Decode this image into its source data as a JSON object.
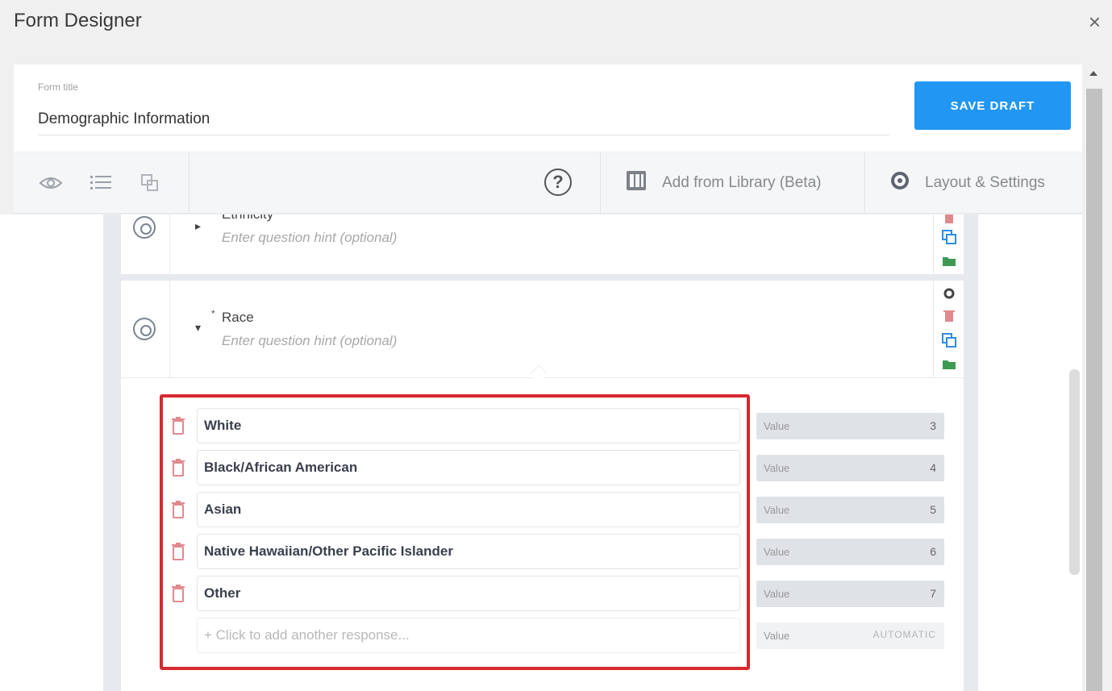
{
  "dialog": {
    "title": "Form Designer",
    "close_glyph": "×"
  },
  "form": {
    "title_label": "Form title",
    "title_value": "Demographic Information",
    "save_label": "SAVE DRAFT"
  },
  "toolbar": {
    "icons": [
      "eye-icon",
      "list-icon",
      "copy-icon"
    ],
    "help_glyph": "?",
    "library_label": "Add from Library (Beta)",
    "settings_label": "Layout & Settings"
  },
  "questions": [
    {
      "label": "Ethnicity",
      "hint_placeholder": "Enter question hint (optional)",
      "caret": "▸"
    },
    {
      "label": "Race",
      "required_mark": "*",
      "hint_placeholder": "Enter question hint (optional)",
      "caret": "▾"
    }
  ],
  "responses": [
    {
      "text": "White",
      "value_label": "Value",
      "value": "3"
    },
    {
      "text": "Black/African American",
      "value_label": "Value",
      "value": "4"
    },
    {
      "text": "Asian",
      "value_label": "Value",
      "value": "5"
    },
    {
      "text": "Native Hawaiian/Other Pacific Islander",
      "value_label": "Value",
      "value": "6"
    },
    {
      "text": "Other",
      "value_label": "Value",
      "value": "7"
    }
  ],
  "add_response": {
    "placeholder": "+ Click to add another response...",
    "value_label": "Value",
    "value": "AUTOMATIC"
  },
  "colors": {
    "accent": "#2196f3",
    "highlight": "#d6292f",
    "trash": "#e08a8e",
    "copy": "#2d8de4",
    "folder": "#3e9a52"
  }
}
